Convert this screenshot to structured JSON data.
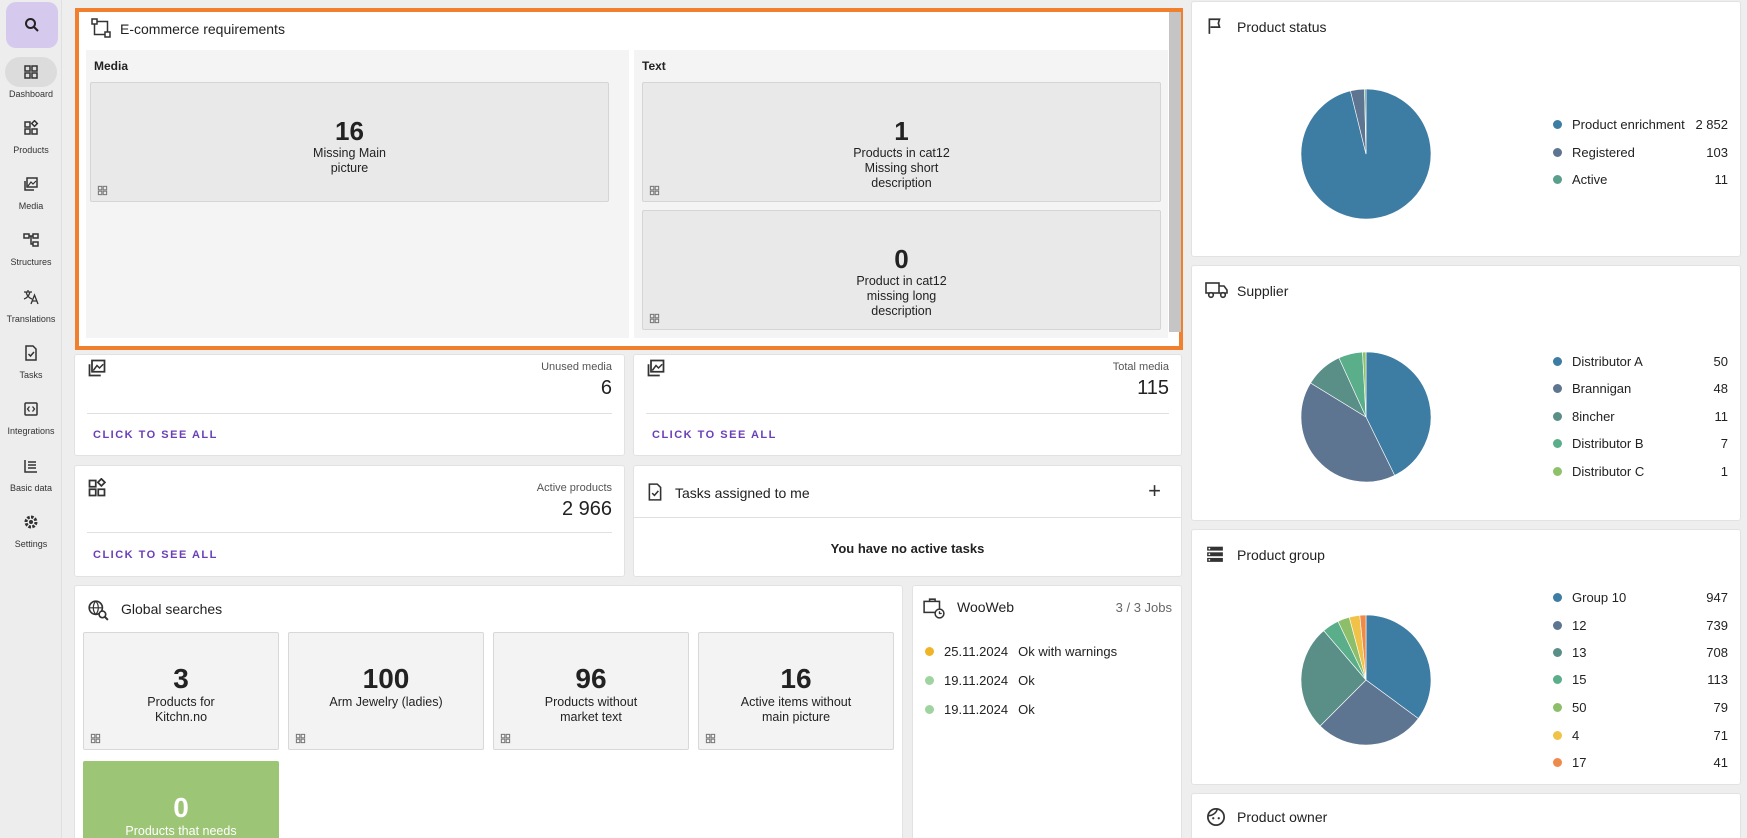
{
  "nav": {
    "items": [
      {
        "label": "Dashboard",
        "icon": "dashboard-icon"
      },
      {
        "label": "Products",
        "icon": "products-icon"
      },
      {
        "label": "Media",
        "icon": "media-icon"
      },
      {
        "label": "Structures",
        "icon": "structures-icon"
      },
      {
        "label": "Translations",
        "icon": "translations-icon"
      },
      {
        "label": "Tasks",
        "icon": "tasks-icon"
      },
      {
        "label": "Integrations",
        "icon": "integrations-icon"
      },
      {
        "label": "Basic data",
        "icon": "basic-data-icon"
      },
      {
        "label": "Settings",
        "icon": "settings-icon"
      }
    ]
  },
  "ecommerce": {
    "title": "E-commerce requirements",
    "media": {
      "title": "Media",
      "tiles": [
        {
          "value": "16",
          "line1": "Missing Main",
          "line2": "picture"
        }
      ]
    },
    "text": {
      "title": "Text",
      "tiles": [
        {
          "value": "1",
          "line1": "Products in cat12",
          "line2": "Missing short",
          "line3": "description"
        },
        {
          "value": "0",
          "line1": "Product in cat12",
          "line2": "missing long",
          "line3": "description"
        }
      ]
    }
  },
  "unused_media": {
    "label": "Unused media",
    "value": "6",
    "link": "CLICK TO SEE ALL"
  },
  "total_media": {
    "label": "Total media",
    "value": "115",
    "link": "CLICK TO SEE ALL"
  },
  "active_products": {
    "label": "Active products",
    "value": "2 966",
    "link": "CLICK TO SEE ALL"
  },
  "tasks": {
    "title": "Tasks assigned to me",
    "empty": "You have no active tasks",
    "add": "+"
  },
  "global_searches": {
    "title": "Global searches",
    "tiles": [
      {
        "value": "3",
        "line1": "Products for",
        "line2": "Kitchn.no"
      },
      {
        "value": "100",
        "line1": "Arm Jewelry (ladies)",
        "line2": ""
      },
      {
        "value": "96",
        "line1": "Products without",
        "line2": "market text"
      },
      {
        "value": "16",
        "line1": "Active items without",
        "line2": "main picture"
      },
      {
        "value": "0",
        "line1": "Products that needs",
        "line2": ""
      }
    ]
  },
  "wooweb": {
    "title": "WooWeb",
    "jobs": "3 / 3 Jobs",
    "rows": [
      {
        "date": "25.11.2024",
        "status": "Ok with warnings",
        "color": "#f0b429"
      },
      {
        "date": "19.11.2024",
        "status": "Ok",
        "color": "#9fd3a0"
      },
      {
        "date": "19.11.2024",
        "status": "Ok",
        "color": "#9fd3a0"
      }
    ]
  },
  "product_status": {
    "title": "Product status",
    "legend": [
      {
        "name": "Product enrichment",
        "value": "2 852",
        "color": "#3d7ca3"
      },
      {
        "name": "Registered",
        "value": "103",
        "color": "#5d7590"
      },
      {
        "name": "Active",
        "value": "11",
        "color": "#5a9e8c"
      }
    ]
  },
  "supplier": {
    "title": "Supplier",
    "legend": [
      {
        "name": "Distributor A",
        "value": "50",
        "color": "#3d7ca3"
      },
      {
        "name": "Brannigan",
        "value": "48",
        "color": "#5d7590"
      },
      {
        "name": "8incher",
        "value": "11",
        "color": "#5a8f88"
      },
      {
        "name": "Distributor B",
        "value": "7",
        "color": "#5aae8a"
      },
      {
        "name": "Distributor C",
        "value": "1",
        "color": "#8dc26b"
      }
    ]
  },
  "product_group": {
    "title": "Product group",
    "legend": [
      {
        "name": "Group 10",
        "value": "947",
        "color": "#3d7ca3"
      },
      {
        "name": "12",
        "value": "739",
        "color": "#5d7590"
      },
      {
        "name": "13",
        "value": "708",
        "color": "#5a8f88"
      },
      {
        "name": "15",
        "value": "113",
        "color": "#5aae8a"
      },
      {
        "name": "50",
        "value": "79",
        "color": "#8dbf6a"
      },
      {
        "name": "4",
        "value": "71",
        "color": "#f0c348"
      },
      {
        "name": "17",
        "value": "41",
        "color": "#ef8a4a"
      }
    ]
  },
  "product_owner": {
    "title": "Product owner"
  },
  "chart_data": [
    {
      "type": "pie",
      "title": "Product status",
      "categories": [
        "Product enrichment",
        "Registered",
        "Active"
      ],
      "values": [
        2852,
        103,
        11
      ]
    },
    {
      "type": "pie",
      "title": "Supplier",
      "categories": [
        "Distributor A",
        "Brannigan",
        "8incher",
        "Distributor B",
        "Distributor C"
      ],
      "values": [
        50,
        48,
        11,
        7,
        1
      ]
    },
    {
      "type": "pie",
      "title": "Product group",
      "categories": [
        "Group 10",
        "12",
        "13",
        "15",
        "50",
        "4",
        "17"
      ],
      "values": [
        947,
        739,
        708,
        113,
        79,
        71,
        41
      ]
    }
  ]
}
